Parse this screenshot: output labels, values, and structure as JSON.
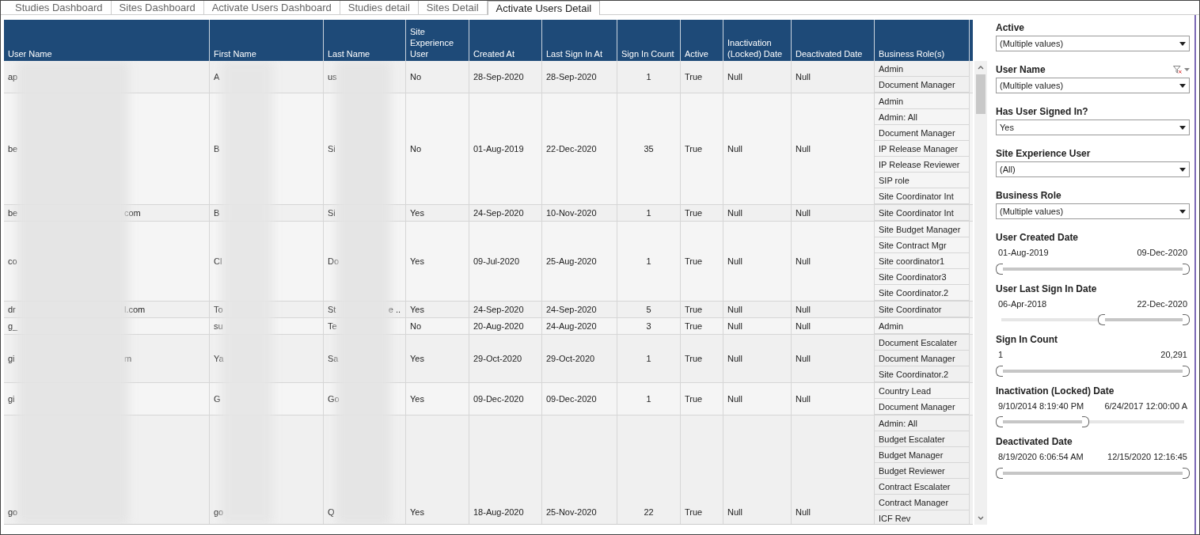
{
  "tabs": [
    {
      "label": "Studies Dashboard",
      "selected": false
    },
    {
      "label": "Sites Dashboard",
      "selected": false
    },
    {
      "label": "Activate Users Dashboard",
      "selected": false
    },
    {
      "label": "Studies detail",
      "selected": false
    },
    {
      "label": "Sites Detail",
      "selected": false
    },
    {
      "label": "Activate Users Detail",
      "selected": true
    }
  ],
  "table": {
    "columns": [
      "User Name",
      "First Name",
      "Last Name",
      "Site Experience User",
      "Created At",
      "Last Sign In At",
      "Sign In Count",
      "Active",
      "Inactivation (Locked) Date",
      "Deactivated Date",
      "Business Role(s)"
    ],
    "rows": [
      {
        "user_name": "ap",
        "first_name": "A",
        "last_name": "us",
        "site_experience_user": "No",
        "created_at": "28-Sep-2020",
        "last_sign_in_at": "28-Sep-2020",
        "sign_in_count": "1",
        "active": "True",
        "inactivation_date": "Null",
        "deactivated_date": "Null",
        "business_roles": [
          "Admin",
          "Document Manager"
        ]
      },
      {
        "user_name": "be",
        "first_name": "B",
        "last_name": "Si",
        "site_experience_user": "No",
        "created_at": "01-Aug-2019",
        "last_sign_in_at": "22-Dec-2020",
        "sign_in_count": "35",
        "active": "True",
        "inactivation_date": "Null",
        "deactivated_date": "Null",
        "business_roles": [
          "Admin",
          "Admin: All",
          "Document Manager",
          "IP Release Manager",
          "IP Release Reviewer",
          "SIP role",
          "Site Coordinator Int"
        ]
      },
      {
        "user_name": "be",
        "user_name_end": "com",
        "first_name": "B",
        "last_name": "Si",
        "site_experience_user": "Yes",
        "created_at": "24-Sep-2020",
        "last_sign_in_at": "10-Nov-2020",
        "sign_in_count": "1",
        "active": "True",
        "inactivation_date": "Null",
        "deactivated_date": "Null",
        "business_roles": [
          "Site Coordinator Int"
        ]
      },
      {
        "user_name": "co",
        "first_name": "Cl",
        "last_name": "Do",
        "site_experience_user": "Yes",
        "created_at": "09-Jul-2020",
        "last_sign_in_at": "25-Aug-2020",
        "sign_in_count": "1",
        "active": "True",
        "inactivation_date": "Null",
        "deactivated_date": "Null",
        "business_roles": [
          "Site Budget Manager",
          "Site Contract Mgr",
          "Site coordinator1",
          "Site Coordinator3",
          "Site Coordinator.2"
        ]
      },
      {
        "user_name": "dr",
        "user_name_end": "l.com",
        "first_name": "To",
        "last_name": "St",
        "last_name_end": "e ..",
        "site_experience_user": "Yes",
        "created_at": "24-Sep-2020",
        "last_sign_in_at": "24-Sep-2020",
        "sign_in_count": "5",
        "active": "True",
        "inactivation_date": "Null",
        "deactivated_date": "Null",
        "business_roles": [
          "Site Coordinator"
        ]
      },
      {
        "user_name": "g_",
        "first_name": "su",
        "last_name": "Te",
        "site_experience_user": "No",
        "created_at": "20-Aug-2020",
        "last_sign_in_at": "24-Aug-2020",
        "sign_in_count": "3",
        "active": "True",
        "inactivation_date": "Null",
        "deactivated_date": "Null",
        "business_roles": [
          "Admin"
        ]
      },
      {
        "user_name": "gi",
        "user_name_end": "m",
        "first_name": "Ya",
        "last_name": "Sa",
        "site_experience_user": "Yes",
        "created_at": "29-Oct-2020",
        "last_sign_in_at": "29-Oct-2020",
        "sign_in_count": "1",
        "active": "True",
        "inactivation_date": "Null",
        "deactivated_date": "Null",
        "business_roles": [
          "Document Escalater",
          "Document Manager",
          "Site Coordinator.2"
        ]
      },
      {
        "user_name": "gi",
        "first_name": "G",
        "last_name": "Go",
        "site_experience_user": "Yes",
        "created_at": "09-Dec-2020",
        "last_sign_in_at": "09-Dec-2020",
        "sign_in_count": "1",
        "active": "True",
        "inactivation_date": "Null",
        "deactivated_date": "Null",
        "business_roles": [
          "Country Lead",
          "Document Manager"
        ]
      },
      {
        "user_name": "go",
        "first_name": "go",
        "last_name": "Q",
        "site_experience_user": "Yes",
        "created_at": "18-Aug-2020",
        "last_sign_in_at": "25-Nov-2020",
        "sign_in_count": "22",
        "active": "True",
        "inactivation_date": "Null",
        "deactivated_date": "Null",
        "business_roles": [
          "Admin: All",
          "Budget Escalater",
          "Budget Manager",
          "Budget Reviewer",
          "Contract Escalater",
          "Contract Manager",
          "ICF Rev"
        ]
      }
    ]
  },
  "filters": [
    {
      "kind": "dropdown",
      "title": "Active",
      "value": "(Multiple values)",
      "clear_filter": false
    },
    {
      "kind": "dropdown",
      "title": "User Name",
      "value": "(Multiple values)",
      "clear_filter": true
    },
    {
      "kind": "dropdown",
      "title": "Has User Signed In?",
      "value": "Yes",
      "clear_filter": false
    },
    {
      "kind": "dropdown",
      "title": "Site Experience User",
      "value": "(All)",
      "clear_filter": false
    },
    {
      "kind": "dropdown",
      "title": "Business Role",
      "value": "(Multiple values)",
      "clear_filter": false
    },
    {
      "kind": "slider",
      "title": "User Created Date",
      "min_label": "01-Aug-2019",
      "max_label": "09-Dec-2020",
      "thumbs": [
        {
          "level": 0
        },
        {
          "level": 1
        }
      ]
    },
    {
      "kind": "slider",
      "title": "User Last Sign In Date",
      "min_label": "06-Apr-2018",
      "max_label": "22-Dec-2020",
      "thumbs": [
        {
          "level": 0.56
        },
        {
          "level": 1
        }
      ]
    },
    {
      "kind": "slider",
      "title": "Sign In Count",
      "min_label": "1",
      "max_label": "20,291",
      "thumbs": [
        {
          "level": 0
        },
        {
          "level": 1
        }
      ]
    },
    {
      "kind": "slider",
      "title": "Inactivation (Locked) Date",
      "min_label": "9/10/2014 8:19:40 PM",
      "max_label": "6/24/2017 12:00:00 A",
      "thumbs": [
        {
          "level": 0
        },
        {
          "level": 0.45
        }
      ]
    },
    {
      "kind": "slider",
      "title": "Deactivated Date",
      "min_label": "8/19/2020 6:06:54 AM",
      "max_label": "12/15/2020 12:16:45",
      "thumbs": [
        {
          "level": 0
        },
        {
          "level": 1
        }
      ]
    }
  ]
}
